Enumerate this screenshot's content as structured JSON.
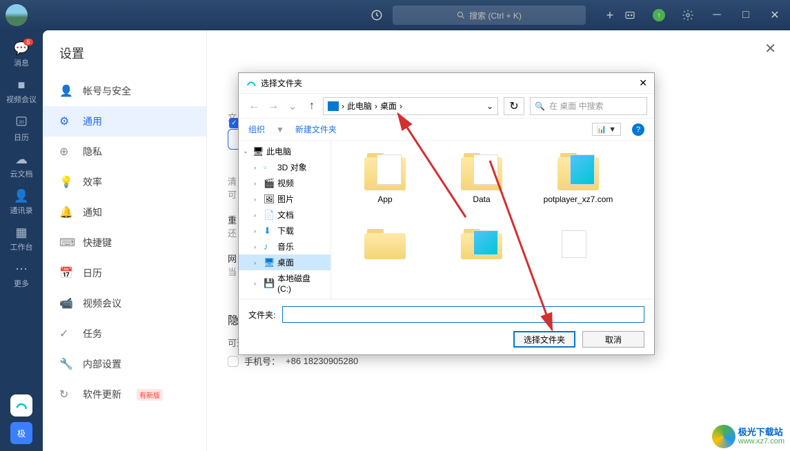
{
  "titlebar": {
    "search_placeholder": "搜索 (Ctrl + K)"
  },
  "rail": {
    "items": [
      {
        "label": "消息",
        "badge": "6"
      },
      {
        "label": "视频会议"
      },
      {
        "label": "日历"
      },
      {
        "label": "云文档"
      },
      {
        "label": "通讯录"
      },
      {
        "label": "工作台"
      },
      {
        "label": "更多"
      }
    ],
    "bottom_label": "极"
  },
  "settings": {
    "title": "设置",
    "nav": [
      {
        "label": "帐号与安全"
      },
      {
        "label": "通用"
      },
      {
        "label": "隐私"
      },
      {
        "label": "效率"
      },
      {
        "label": "通知"
      },
      {
        "label": "快捷键"
      },
      {
        "label": "日历"
      },
      {
        "label": "视频会议"
      },
      {
        "label": "任务"
      },
      {
        "label": "内部设置"
      },
      {
        "label": "软件更新",
        "badge": "有新版"
      }
    ],
    "content": {
      "section_letter": "文",
      "panel_text2": "清",
      "panel_text3": "可",
      "panel_text4": "重",
      "panel_text5": "还",
      "panel_text6": "网",
      "panel_text7": "当",
      "privacy_title": "隐私",
      "privacy_sub": "可通过以下方式搜索到我",
      "phone_label": "手机号：",
      "phone_value": "+86 18230905280"
    }
  },
  "dialog": {
    "title": "选择文件夹",
    "breadcrumb": {
      "root": "此电脑",
      "current": "桌面"
    },
    "search_placeholder": "在 桌面 中搜索",
    "toolbar": {
      "organize": "组织",
      "new_folder": "新建文件夹"
    },
    "tree": [
      {
        "label": "此电脑",
        "icon": "pc",
        "expanded": true
      },
      {
        "label": "3D 对象",
        "icon": "3d"
      },
      {
        "label": "视频",
        "icon": "video"
      },
      {
        "label": "图片",
        "icon": "image"
      },
      {
        "label": "文档",
        "icon": "doc"
      },
      {
        "label": "下载",
        "icon": "download"
      },
      {
        "label": "音乐",
        "icon": "music"
      },
      {
        "label": "桌面",
        "icon": "desktop",
        "selected": true
      },
      {
        "label": "本地磁盘 (C:)",
        "icon": "disk"
      }
    ],
    "folders": [
      {
        "name": "App"
      },
      {
        "name": "Data"
      },
      {
        "name": "potplayer_xz7.com"
      },
      {
        "name": ""
      },
      {
        "name": ""
      },
      {
        "name": ""
      }
    ],
    "folder_label": "文件夹:",
    "select_btn": "选择文件夹",
    "cancel_btn": "取消"
  },
  "watermark": {
    "line1": "极光下载站",
    "line2": "www.xz7.com"
  }
}
